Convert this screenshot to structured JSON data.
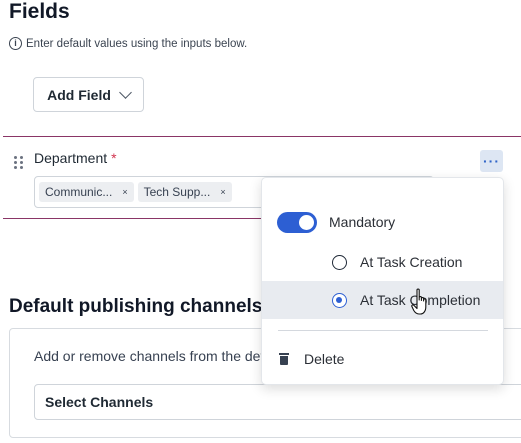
{
  "fields": {
    "title": "Fields",
    "info_text": "Enter default values using the inputs below.",
    "add_field_label": "Add Field"
  },
  "field": {
    "label": "Department",
    "required_marker": "*",
    "more_label": "···",
    "tags": [
      {
        "label": "Communic...",
        "remove": "×"
      },
      {
        "label": "Tech Supp...",
        "remove": "×"
      }
    ]
  },
  "menu": {
    "mandatory_label": "Mandatory",
    "mandatory_on": true,
    "options": [
      {
        "label": "At Task Creation",
        "selected": false
      },
      {
        "label": "At Task Completion",
        "selected": true
      }
    ],
    "delete_label": "Delete"
  },
  "publishing": {
    "title": "Default publishing channels",
    "description": "Add or remove channels from the default list.",
    "select_label": "Select Channels"
  },
  "colors": {
    "accent": "#2d5fd3",
    "divider": "#8a3566",
    "required": "#d1344f",
    "hover_row": "#e8ebf0"
  }
}
